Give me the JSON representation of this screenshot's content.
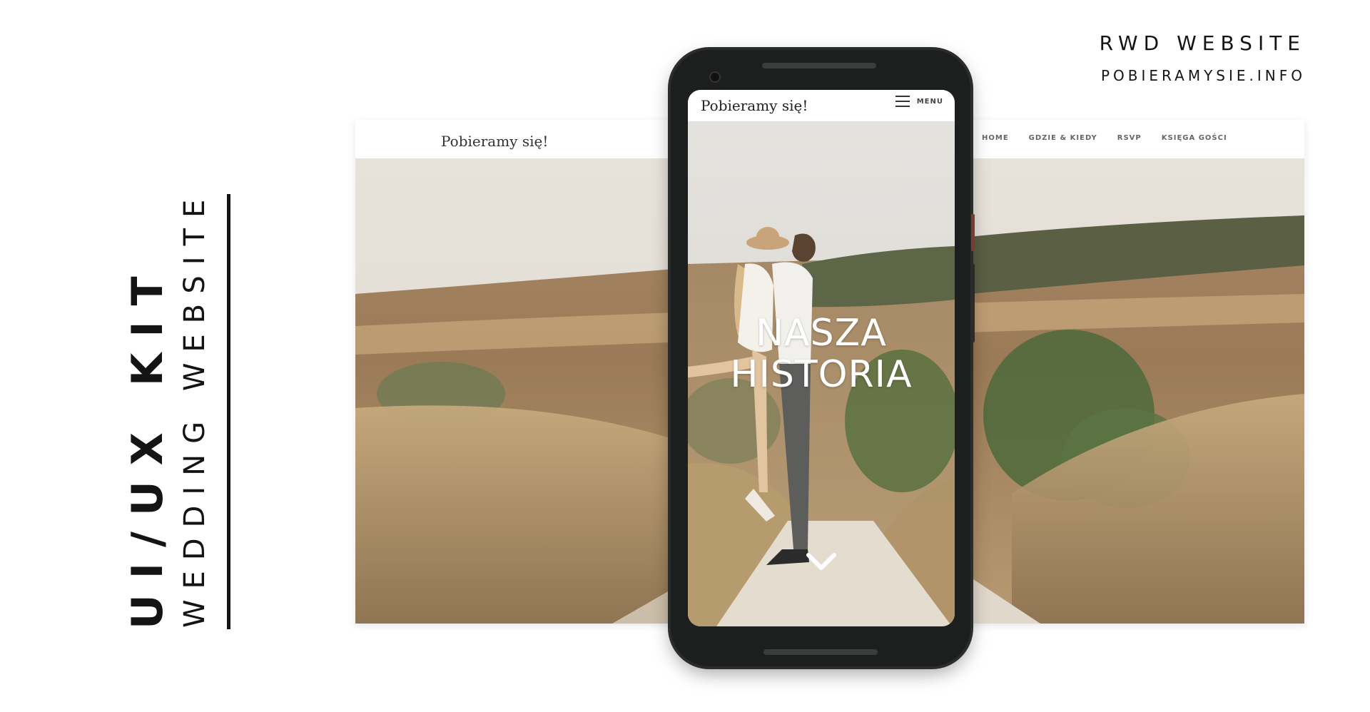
{
  "left_panel": {
    "kit_title": "UI/UX KIT",
    "subtitle": "WEDDING WEBSITE"
  },
  "top_right": {
    "label": "RWD WEBSITE",
    "url": "POBIERAMYSIE.INFO"
  },
  "desktop": {
    "logo": "Pobieramy się!",
    "nav": [
      "HOME",
      "GDZIE & KIEDY",
      "RSVP",
      "KSIĘGA GOŚCI"
    ]
  },
  "phone": {
    "logo": "Pobieramy się!",
    "menu_label": "MENU",
    "hero_title_line1": "NASZA",
    "hero_title_line2": "HISTORIA",
    "scroll_icon": "chevron-down-icon"
  }
}
